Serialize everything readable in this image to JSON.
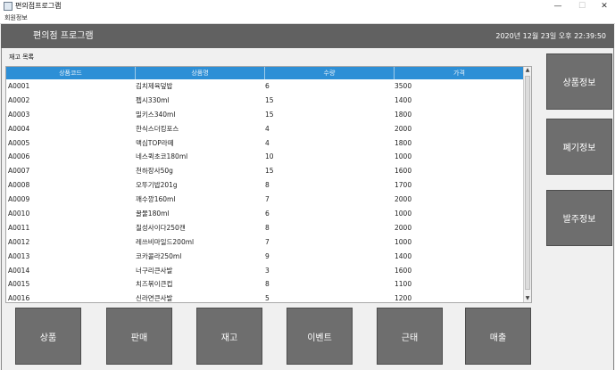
{
  "window": {
    "title": "편의점프로그램",
    "minimize": "—",
    "maximize": "☐",
    "close": "✕"
  },
  "menubar": {
    "items": [
      "회원정보"
    ]
  },
  "header": {
    "title": "편의점 프로그램",
    "datetime": "2020년 12월 23일 오후 22:39:50"
  },
  "inventory": {
    "label": "재고 목록",
    "columns": [
      "상품코드",
      "상품명",
      "수량",
      "가격"
    ],
    "rows": [
      [
        "A0001",
        "김치제육덮밥",
        "6",
        "3500"
      ],
      [
        "A0002",
        "펩시330ml",
        "15",
        "1400"
      ],
      [
        "A0003",
        "밀키스340ml",
        "15",
        "1800"
      ],
      [
        "A0004",
        "한식스더킹포스",
        "4",
        "2000"
      ],
      [
        "A0005",
        "맥심TOP라떼",
        "4",
        "1800"
      ],
      [
        "A0006",
        "네스퀵초코180ml",
        "10",
        "1000"
      ],
      [
        "A0007",
        "천하장사50g",
        "15",
        "1600"
      ],
      [
        "A0008",
        "오뚜기밥201g",
        "8",
        "1700"
      ],
      [
        "A0009",
        "깨수깡160ml",
        "7",
        "2000"
      ],
      [
        "A0010",
        "꿀물180ml",
        "6",
        "1000"
      ],
      [
        "A0011",
        "칠성사이다250캔",
        "8",
        "2000"
      ],
      [
        "A0012",
        "레쓰비마일드200ml",
        "7",
        "1000"
      ],
      [
        "A0013",
        "코카콜라250ml",
        "9",
        "1400"
      ],
      [
        "A0014",
        "너구리큰사발",
        "3",
        "1600"
      ],
      [
        "A0015",
        "치즈볶이큰컵",
        "8",
        "1100"
      ],
      [
        "A0016",
        "신라면큰사발",
        "5",
        "1200"
      ]
    ]
  },
  "side_buttons": [
    "상품정보",
    "폐기정보",
    "발주정보"
  ],
  "bottom_buttons": [
    "상품",
    "판매",
    "재고",
    "이벤트",
    "근태",
    "매출"
  ]
}
